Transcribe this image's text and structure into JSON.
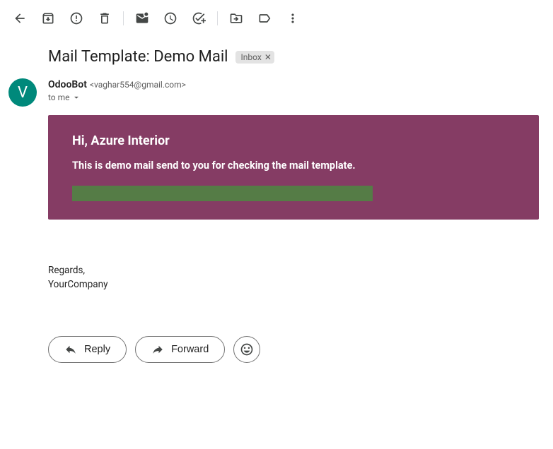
{
  "subject": "Mail Template: Demo Mail",
  "label": {
    "name": "Inbox"
  },
  "sender": {
    "name": "OdooBot",
    "email": "<vaghar554@gmail.com>",
    "avatar_initial": "V",
    "recipient_line": "to me"
  },
  "body": {
    "greeting": "Hi, Azure Interior",
    "message": "This is demo mail send to you for checking the mail template."
  },
  "signature": {
    "line1": "Regards,",
    "line2": "YourCompany"
  },
  "actions": {
    "reply": "Reply",
    "forward": "Forward"
  },
  "toolbar": {
    "back": "Back",
    "archive": "Archive",
    "spam": "Report spam",
    "delete": "Delete",
    "unread": "Mark as unread",
    "snooze": "Snooze",
    "task": "Add to tasks",
    "move": "Move to",
    "labels": "Labels",
    "more": "More"
  }
}
